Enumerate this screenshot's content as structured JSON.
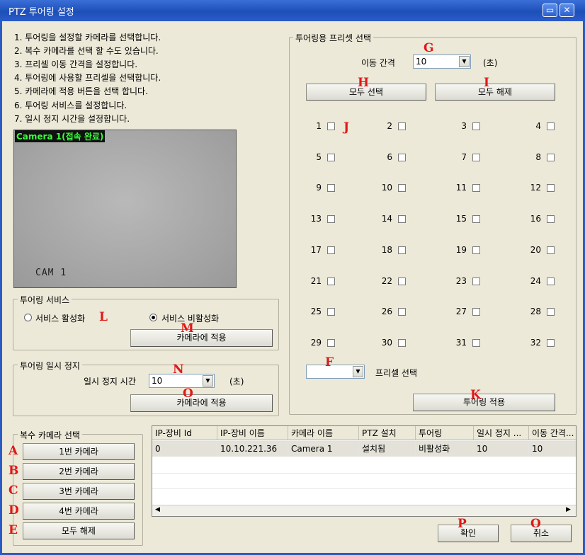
{
  "window": {
    "title": "PTZ 투어링 설정",
    "minimize": "▭",
    "close": "✕"
  },
  "steps": [
    "1. 투어링을 설정할 카메라를 선택합니다.",
    "2. 복수 카메라를 선택 할 수도 있습니다.",
    "3. 프리셀 이동 간격을 설정합니다.",
    "4. 투어링에 사용할 프리셀을 선택합니다.",
    "5. 카메라에 적용 버튼을 선택 합니다.",
    "6. 투어링 서비스를 설정합니다.",
    "7. 일시 정지 시간을 설정합니다."
  ],
  "camera": {
    "overlay": "Camera 1(접속 완료)",
    "id_text": "CAM 1"
  },
  "service": {
    "group_label": "투어링 서비스",
    "enable_label": "서비스 활성화",
    "disable_label": "서비스 비활성화",
    "selected": "disable",
    "apply_label": "카메라에 적용"
  },
  "pause": {
    "group_label": "투어링 일시 정지",
    "time_label": "일시 정지 시간",
    "time_value": "10",
    "unit": "(초)",
    "apply_label": "카메라에 적용"
  },
  "multi": {
    "group_label": "복수 카메라 선택",
    "buttons": [
      "1번 카메라",
      "2번 카메라",
      "3번 카메라",
      "4번 카메라",
      "모두 해제"
    ]
  },
  "preset": {
    "group_label": "투어링용 프리셋 선택",
    "interval_label": "이동 간격",
    "interval_value": "10",
    "unit": "(초)",
    "select_all": "모두 선택",
    "clear_all": "모두 해제",
    "numbers": [
      "1",
      "2",
      "3",
      "4",
      "5",
      "6",
      "7",
      "8",
      "9",
      "10",
      "11",
      "12",
      "13",
      "14",
      "15",
      "16",
      "17",
      "18",
      "19",
      "20",
      "21",
      "22",
      "23",
      "24",
      "25",
      "26",
      "27",
      "28",
      "29",
      "30",
      "31",
      "32"
    ],
    "combo_value": "",
    "select_label": "프리셀 선택",
    "apply_label": "투어링 적용"
  },
  "table": {
    "headers": [
      "IP-장비 Id",
      "IP-장비 이름",
      "카메라 이름",
      "PTZ 설치",
      "투어링",
      "일시 정지 ...",
      "이동 간격..."
    ],
    "rows": [
      [
        "0",
        "10.10.221.36",
        "Camera 1",
        "설치됨",
        "비활성화",
        "10",
        "10"
      ]
    ]
  },
  "footer": {
    "ok": "확인",
    "cancel": "취소"
  },
  "markers": {
    "A": "A",
    "B": "B",
    "C": "C",
    "D": "D",
    "E": "E",
    "F": "F",
    "G": "G",
    "H": "H",
    "I": "I",
    "J": "J",
    "K": "K",
    "L": "L",
    "M": "M",
    "N": "N",
    "O1": "O",
    "O2": "O",
    "P": "P"
  }
}
